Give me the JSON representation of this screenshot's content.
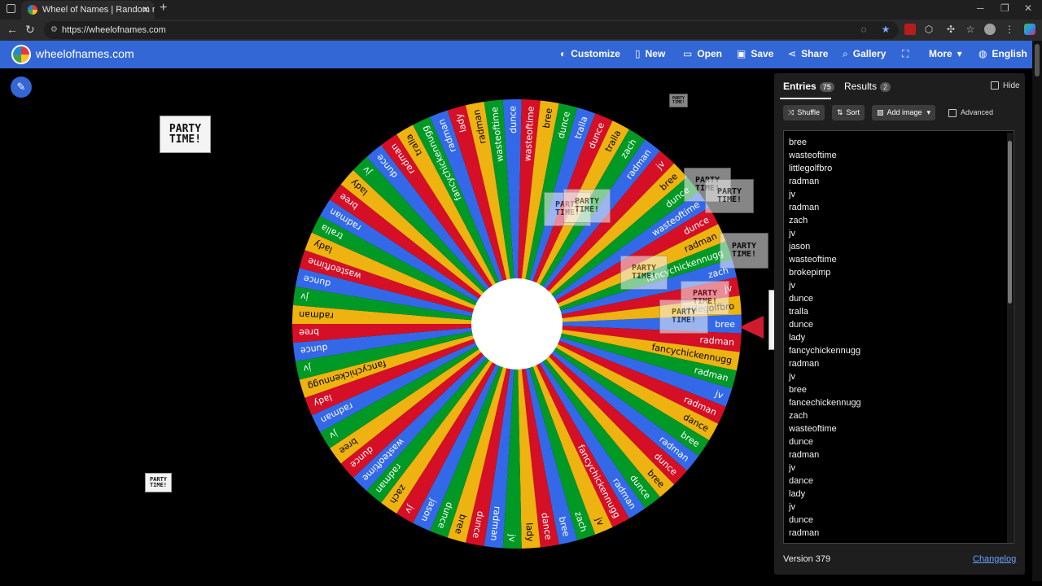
{
  "browser": {
    "tab_title": "Wheel of Names | Random name",
    "url": "https://wheelofnames.com"
  },
  "app": {
    "brand": "wheelofnames.com",
    "menu": [
      {
        "label": "Customize",
        "icon": "palette-icon"
      },
      {
        "label": "New",
        "icon": "new-file-icon"
      },
      {
        "label": "Open",
        "icon": "folder-icon"
      },
      {
        "label": "Save",
        "icon": "save-icon"
      },
      {
        "label": "Share",
        "icon": "share-icon"
      },
      {
        "label": "Gallery",
        "icon": "search-icon"
      },
      {
        "label": "",
        "icon": "fullscreen-icon"
      },
      {
        "label": "More",
        "icon": "chevron-down-icon"
      },
      {
        "label": "English",
        "icon": "globe-icon"
      }
    ]
  },
  "party": {
    "line1": "PARTY",
    "line2": "TIME!"
  },
  "wheel": {
    "colors": [
      "#3369e8",
      "#d50f25",
      "#eeb211",
      "#009925"
    ],
    "labels": [
      "bree",
      "radman",
      "fancychickennugg",
      "radman",
      "jv",
      "radman",
      "dance",
      "bree",
      "radman",
      "dunce",
      "bree",
      "dunce",
      "radman",
      "fancychickennugg",
      "jv",
      "zach",
      "bree",
      "dance",
      "lady",
      "jv",
      "radman",
      "dunce",
      "bree",
      "dunce",
      "jason",
      "jv",
      "zach",
      "radman",
      "wasteoftime",
      "dunce",
      "bree",
      "jv",
      "radman",
      "lady",
      "fancychickennugg",
      "jv",
      "dunce",
      "bree",
      "radman",
      "jv",
      "dunce",
      "wasteoftime",
      "lady",
      "tralla",
      "radman",
      "bree",
      "lady",
      "jv",
      "dunce",
      "radman",
      "tralla",
      "fancychickennugg",
      "radman",
      "lady",
      "radman",
      "wasteoftime",
      "dunce",
      "wasteoftime",
      "bree",
      "dunce",
      "tralla",
      "dunce",
      "tralla",
      "zach",
      "radman",
      "jv",
      "bree",
      "dunce",
      "wasteoftime",
      "dunce",
      "radman",
      "fancychickennugg",
      "zach",
      "jv",
      "littlegolfbro"
    ]
  },
  "panel": {
    "tab_entries": "Entries",
    "entries_count": "75",
    "tab_results": "Results",
    "results_count": "2",
    "hide_label": "Hide",
    "shuffle_label": "Shuffle",
    "sort_label": "Sort",
    "add_image_label": "Add image",
    "advanced_label": "Advanced",
    "entries": [
      "bree",
      "wasteoftime",
      "littlegolfbro",
      "radman",
      "jv",
      "radman",
      "zach",
      "jv",
      "jason",
      "wasteoftime",
      "brokepimp",
      "jv",
      "dunce",
      "tralla",
      "dunce",
      "lady",
      "fancychickennugg",
      "radman",
      "jv",
      "bree",
      "fancechickennugg",
      "zach",
      "wasteoftime",
      "dunce",
      "radman",
      "jv",
      "dance",
      "lady",
      "jv",
      "dunce",
      "radman"
    ],
    "version": "Version 379",
    "changelog": "Changelog"
  }
}
